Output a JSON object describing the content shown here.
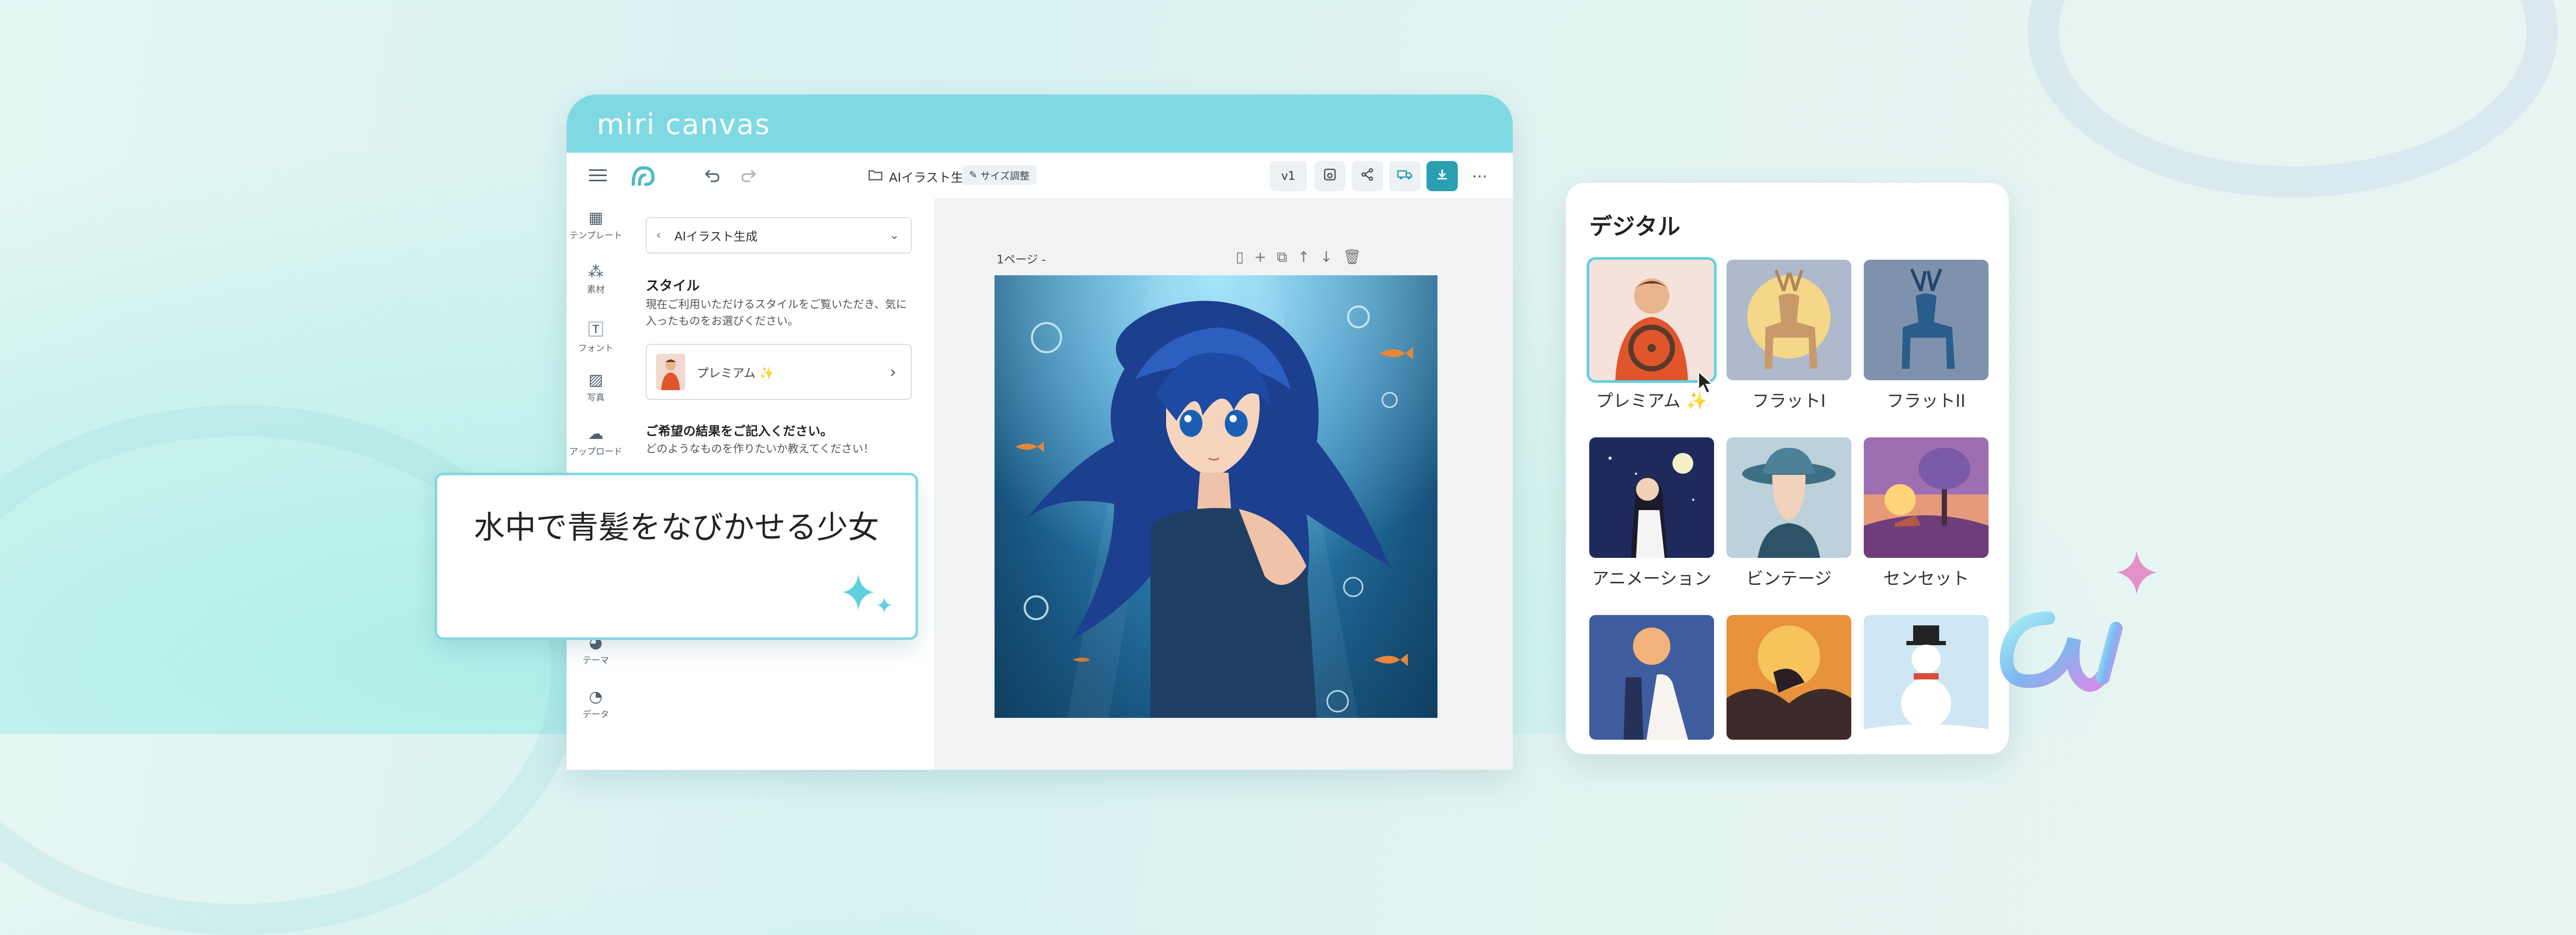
{
  "brand": {
    "logo": "miri canvas"
  },
  "toolbar": {
    "menu_icon": "hamburger-icon",
    "undo_icon": "undo-icon",
    "redo_icon": "redo-icon",
    "doc_title": "AIイラスト生成",
    "resize_label": "サイズ調整",
    "version_label": "v1"
  },
  "sidebar": {
    "items": [
      {
        "label": "テンプレート",
        "icon": "template-icon"
      },
      {
        "label": "素材",
        "icon": "elements-icon"
      },
      {
        "label": "フォント",
        "icon": "font-icon"
      },
      {
        "label": "写真",
        "icon": "photo-icon"
      },
      {
        "label": "アップロード",
        "icon": "upload-icon"
      },
      {
        "label": "テーマ",
        "icon": "palette-icon"
      },
      {
        "label": "データ",
        "icon": "chart-icon"
      }
    ]
  },
  "panel": {
    "select_label": "AIイラスト生成",
    "style_heading": "スタイル",
    "style_desc": "現在ご利用いただけるスタイルをご覧いただき、気に入ったものをお選びください。",
    "style_selected": "プレミアム ✨",
    "result_heading": "ご希望の結果をご記入ください。",
    "result_desc": "どのようなものを作りたいか教えてください！"
  },
  "canvas": {
    "page_label": "1ページ -"
  },
  "prompt": {
    "text": "水中で青髪をなびかせる少女"
  },
  "style_panel": {
    "title": "デジタル",
    "tiles": [
      {
        "label": "プレミアム ✨",
        "selected": true
      },
      {
        "label": "フラットI",
        "selected": false
      },
      {
        "label": "フラットII",
        "selected": false
      },
      {
        "label": "アニメーション",
        "selected": false
      },
      {
        "label": "ビンテージ",
        "selected": false
      },
      {
        "label": "センセット",
        "selected": false
      },
      {
        "label": "",
        "selected": false
      },
      {
        "label": "",
        "selected": false
      },
      {
        "label": "",
        "selected": false
      }
    ]
  },
  "colors": {
    "brand": "#7fd9e3",
    "accent": "#2a9fb1",
    "selection": "#5ed0e0"
  }
}
